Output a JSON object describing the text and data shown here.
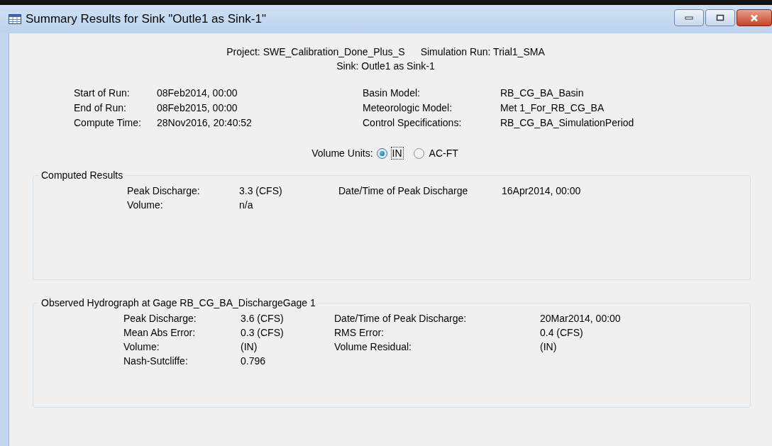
{
  "window": {
    "title": "Summary Results for Sink \"Outle1 as Sink-1\""
  },
  "header": {
    "project": "Project: SWE_Calibration_Done_Plus_S",
    "simulation_run": "Simulation Run: Trial1_SMA",
    "sink": "Sink: Outle1 as Sink-1"
  },
  "run_info": [
    {
      "label": "Start of Run:",
      "value": "08Feb2014, 00:00",
      "label_2": "Basin Model:",
      "value_2": "RB_CG_BA_Basin"
    },
    {
      "label": "End of Run:",
      "value": "08Feb2015, 00:00",
      "label_2": "Meteorologic Model:",
      "value_2": "Met 1_For_RB_CG_BA"
    },
    {
      "label": "Compute Time:",
      "value": "28Nov2016, 20:40:52",
      "label_2": "Control Specifications:",
      "value_2": "RB_CG_BA_SimulationPeriod"
    }
  ],
  "volume_units": {
    "label": "Volume Units:",
    "options": [
      {
        "label": "IN",
        "selected": true,
        "focused": true
      },
      {
        "label": "AC-FT",
        "selected": false,
        "focused": false
      }
    ]
  },
  "computed_results": {
    "title": "Computed Results",
    "rows": [
      {
        "label": "Peak Discharge:",
        "value": "3.3 (CFS)",
        "label_2": "Date/Time of Peak Discharge",
        "value_2": "16Apr2014, 00:00"
      },
      {
        "label": "Volume:",
        "value": "n/a"
      }
    ]
  },
  "observed_hydrograph": {
    "title": "Observed Hydrograph at Gage RB_CG_BA_DischargeGage 1",
    "rows": [
      {
        "label": "Peak Discharge:",
        "value": "3.6 (CFS)",
        "label_2": "Date/Time of Peak Discharge:",
        "value_2": "20Mar2014, 00:00"
      },
      {
        "label": "Mean Abs Error:",
        "value": "0.3 (CFS)",
        "label_2": "RMS Error:",
        "value_2": "0.4 (CFS)"
      },
      {
        "label": "Volume:",
        "value": "(IN)",
        "label_2": "Volume Residual:",
        "value_2": "(IN)"
      },
      {
        "label": "Nash-Sutcliffe:",
        "value": "0.796"
      }
    ]
  }
}
